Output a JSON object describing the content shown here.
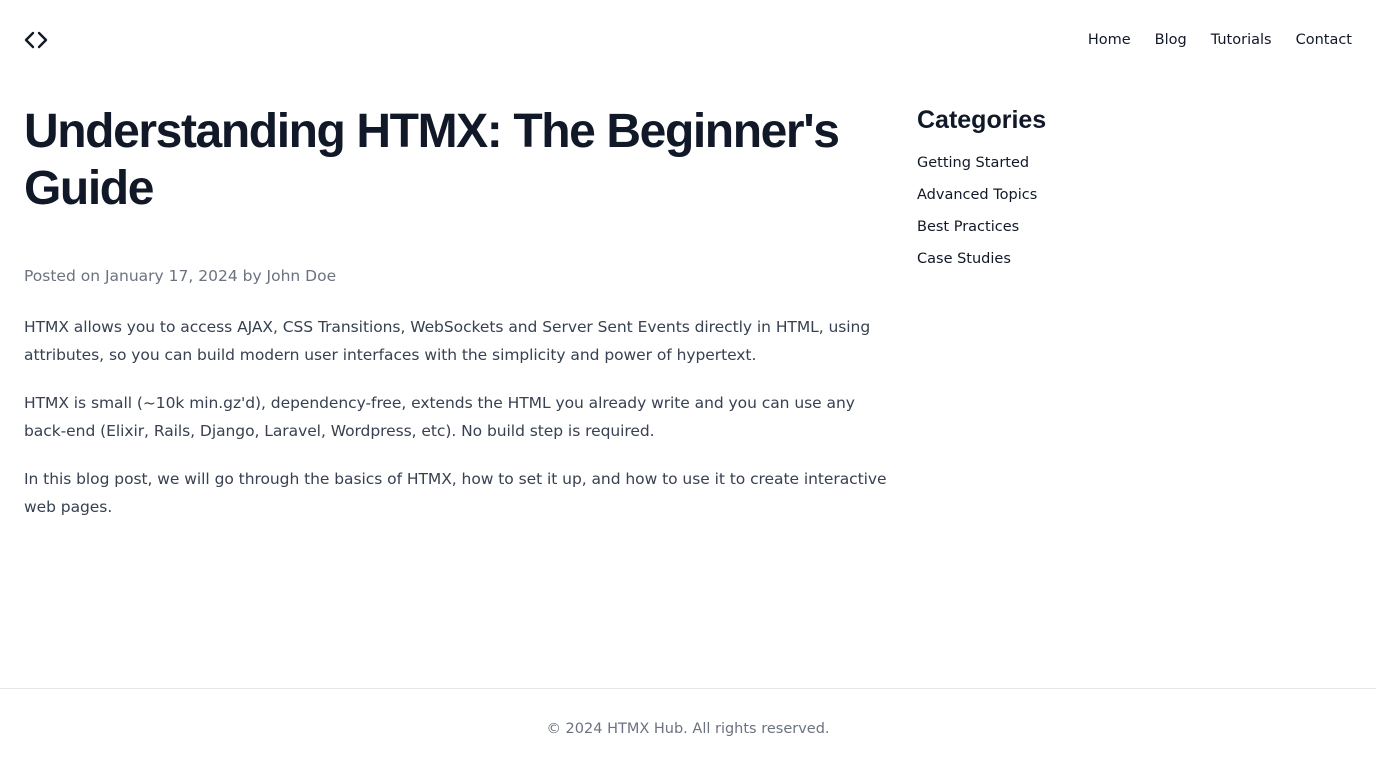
{
  "header": {
    "logo_icon": "code-brackets-icon",
    "nav": {
      "home": "Home",
      "blog": "Blog",
      "tutorials": "Tutorials",
      "contact": "Contact"
    }
  },
  "article": {
    "title": "Understanding HTMX: The Beginner's Guide",
    "meta": "Posted on January 17, 2024 by John Doe",
    "paragraphs": [
      "HTMX allows you to access AJAX, CSS Transitions, WebSockets and Server Sent Events directly in HTML, using attributes, so you can build modern user interfaces with the simplicity and power of hypertext.",
      "HTMX is small (~10k min.gz'd), dependency-free, extends the HTML you already write and you can use any back-end (Elixir, Rails, Django, Laravel, Wordpress, etc). No build step is required.",
      "In this blog post, we will go through the basics of HTMX, how to set it up, and how to use it to create interactive web pages."
    ]
  },
  "sidebar": {
    "title": "Categories",
    "items": [
      "Getting Started",
      "Advanced Topics",
      "Best Practices",
      "Case Studies"
    ]
  },
  "footer": {
    "text": "© 2024 HTMX Hub. All rights reserved."
  },
  "colors": {
    "heading": "#111827",
    "body_text": "#374151",
    "muted_text": "#6b7280",
    "divider": "#e5e7eb",
    "background": "#ffffff"
  }
}
